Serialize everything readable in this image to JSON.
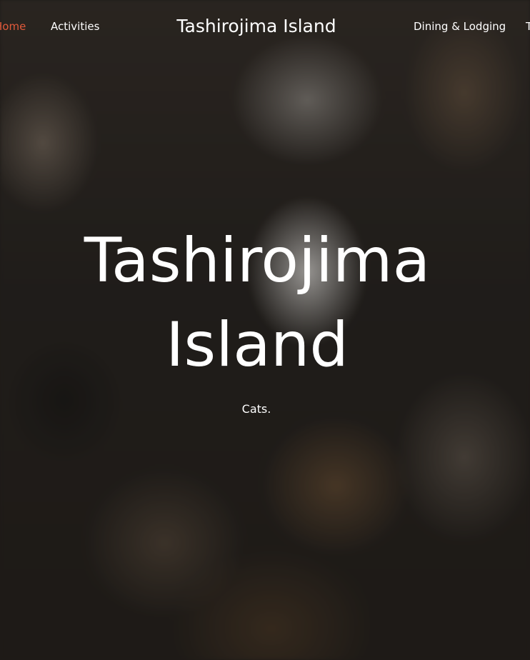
{
  "nav": {
    "items": [
      {
        "label": "Home",
        "active": true
      },
      {
        "label": "Activities",
        "active": false
      },
      {
        "label": "Dining & Lodging",
        "active": false
      },
      {
        "label": "T",
        "active": false
      }
    ],
    "site_title": "Tashirojima Island"
  },
  "hero": {
    "title_line1": "Tashirojima",
    "title_line2": "Island",
    "subtitle": "Cats."
  },
  "colors": {
    "active_nav": "#e0593a",
    "text": "#ffffff"
  }
}
